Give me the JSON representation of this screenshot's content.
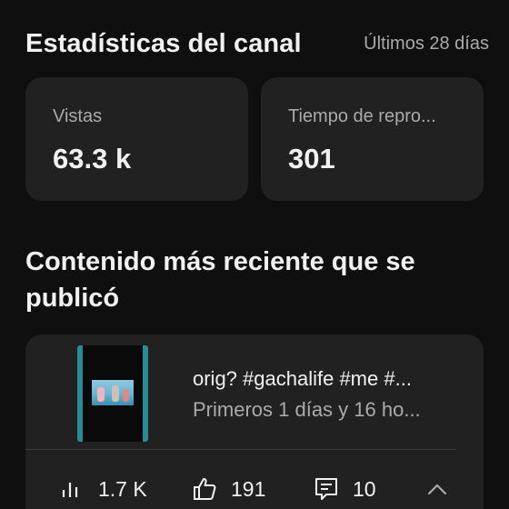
{
  "stats": {
    "title": "Estadísticas del canal",
    "range": "Últimos 28 días",
    "cards": [
      {
        "label": "Vistas",
        "value": "63.3 k"
      },
      {
        "label": "Tiempo de repro...",
        "value": "301"
      }
    ]
  },
  "recent": {
    "section_title": "Contenido más reciente que se publicó",
    "video": {
      "title": "orig? #gachalife #me #...",
      "subtitle": "Primeros 1 días y 16 ho...",
      "views": "1.7 K",
      "likes": "191",
      "comments": "10"
    }
  },
  "icons": {
    "views": "bar-chart-icon",
    "likes": "thumbs-up-icon",
    "comments": "comment-icon",
    "expand": "chevron-up-icon"
  },
  "colors": {
    "background": "#0f0f0f",
    "card": "#212121",
    "text_primary": "#f1f1f1",
    "text_secondary": "#aaaaaa",
    "thumbnail_accent": "#2a8b95"
  }
}
